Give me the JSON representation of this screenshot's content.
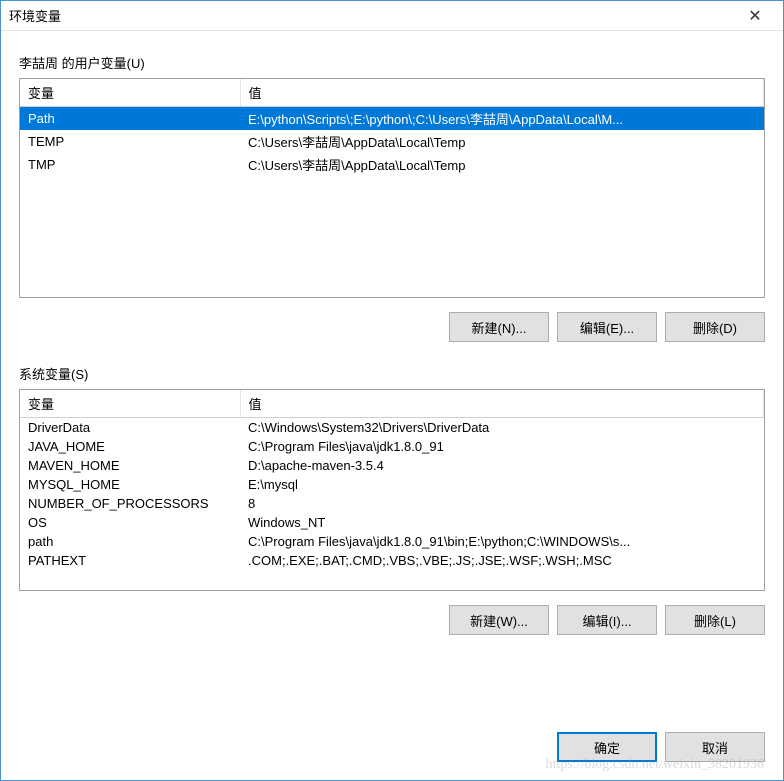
{
  "window": {
    "title": "环境变量"
  },
  "user_section": {
    "label": "李喆周 的用户变量(U)",
    "header_var": "变量",
    "header_val": "值",
    "rows": [
      {
        "name": "Path",
        "value": "E:\\python\\Scripts\\;E:\\python\\;C:\\Users\\李喆周\\AppData\\Local\\M...",
        "selected": true
      },
      {
        "name": "TEMP",
        "value": "C:\\Users\\李喆周\\AppData\\Local\\Temp",
        "selected": false
      },
      {
        "name": "TMP",
        "value": "C:\\Users\\李喆周\\AppData\\Local\\Temp",
        "selected": false
      }
    ],
    "buttons": {
      "new": "新建(N)...",
      "edit": "编辑(E)...",
      "delete": "删除(D)"
    }
  },
  "system_section": {
    "label": "系统变量(S)",
    "header_var": "变量",
    "header_val": "值",
    "rows": [
      {
        "name": "DriverData",
        "value": "C:\\Windows\\System32\\Drivers\\DriverData"
      },
      {
        "name": "JAVA_HOME",
        "value": "C:\\Program Files\\java\\jdk1.8.0_91"
      },
      {
        "name": "MAVEN_HOME",
        "value": "D:\\apache-maven-3.5.4"
      },
      {
        "name": "MYSQL_HOME",
        "value": "E:\\mysql"
      },
      {
        "name": "NUMBER_OF_PROCESSORS",
        "value": "8"
      },
      {
        "name": "OS",
        "value": "Windows_NT"
      },
      {
        "name": "path",
        "value": "C:\\Program Files\\java\\jdk1.8.0_91\\bin;E:\\python;C:\\WINDOWS\\s..."
      },
      {
        "name": "PATHEXT",
        "value": ".COM;.EXE;.BAT;.CMD;.VBS;.VBE;.JS;.JSE;.WSF;.WSH;.MSC"
      }
    ],
    "buttons": {
      "new": "新建(W)...",
      "edit": "编辑(I)...",
      "delete": "删除(L)"
    }
  },
  "footer": {
    "ok": "确定",
    "cancel": "取消"
  },
  "watermark": "https://blog.csdn.net/weixin_38201936"
}
